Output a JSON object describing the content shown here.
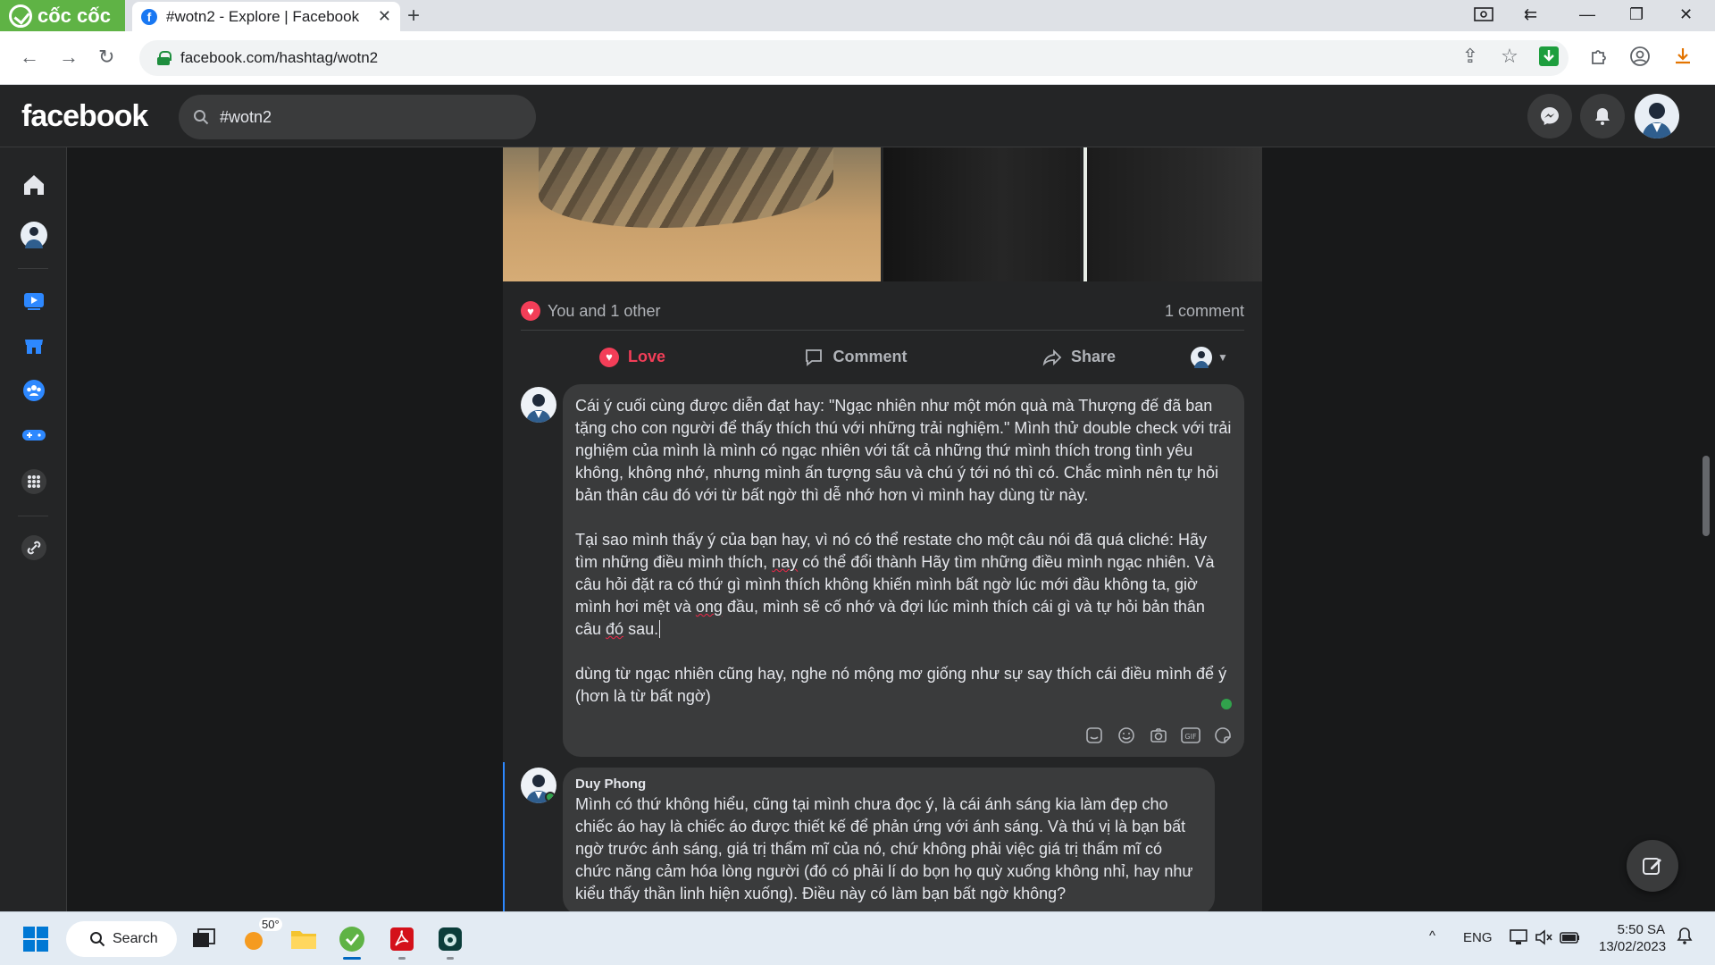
{
  "browser": {
    "brand": "cốc cốc",
    "tab_title": "#wotn2 - Explore | Facebook",
    "url": "facebook.com/hashtag/wotn2"
  },
  "header": {
    "logo": "facebook",
    "search_value": "#wotn2"
  },
  "post": {
    "reactions_text": "You and 1 other",
    "comment_count": "1 comment",
    "actions": {
      "love": "Love",
      "comment": "Comment",
      "share": "Share"
    }
  },
  "composer": {
    "paragraph1": "Cái ý cuối cùng được diễn đạt hay: \"Ngạc nhiên như một món quà mà Thượng đế đã ban tặng cho con người để thấy thích thú với những trải nghiệm.\" Mình thử double check với trải nghiệm của mình là mình có ngạc nhiên với tất cả những thứ mình thích trong tình yêu không, không nhớ, nhưng mình ấn tượng sâu và chú ý tới nó thì có. Chắc mình nên tự hỏi bản thân câu đó với từ bất ngờ thì dễ nhớ hơn vì mình hay dùng từ này.",
    "p2_part1": "Tại sao mình thấy ý của bạn hay, vì nó có thể restate cho một câu nói đã quá cliché: Hãy tìm những điều mình thích, ",
    "p2_word_nay": "nay",
    "p2_part2": " có thể đổi thành Hãy tìm những điều mình ngạc nhiên. Và câu hỏi đặt ra có thứ gì mình thích không khiến mình bất ngờ lúc mới đầu không ta, giờ mình hơi mệt và ",
    "p2_word_ong": "ong",
    "p2_part3": " đầu, mình sẽ cố nhớ và đợi lúc mình thích cái gì và tự hỏi bản thân câu ",
    "p2_word_do": "đó",
    "p2_part4": " sau.",
    "paragraph3": "dùng từ ngạc nhiên cũng hay, nghe nó mộng mơ giống như sự say thích cái điều mình để ý (hơn là từ bất ngờ)",
    "tool_icons": [
      "sticker-icon",
      "emoji-icon",
      "camera-icon",
      "gif-icon",
      "sticker-face-icon"
    ]
  },
  "reply": {
    "author": "Duy Phong",
    "text": "Mình có thứ không hiểu, cũng tại mình chưa đọc ý, là cái ánh sáng kia làm đẹp cho chiếc áo hay là chiếc áo được thiết kế để phản ứng với ánh sáng. Và thú vị là bạn bất ngờ trước ánh sáng, giá trị thẩm mĩ của nó, chứ không phải việc giá trị thẩm mĩ có chức năng cảm hóa lòng người (đó có phải lí do bọn họ quỳ xuống không nhỉ, hay như kiểu thấy thần linh hiện xuống). Điều này có làm bạn bất ngờ không?"
  },
  "taskbar": {
    "search_label": "Search",
    "weather": "50°",
    "language": "ENG",
    "time": "5:50 SA",
    "date": "13/02/2023"
  },
  "colors": {
    "facebook_blue": "#1877f2",
    "love_red": "#f33e58",
    "coccoc_green": "#5fb345",
    "online_green": "#31a24c"
  }
}
